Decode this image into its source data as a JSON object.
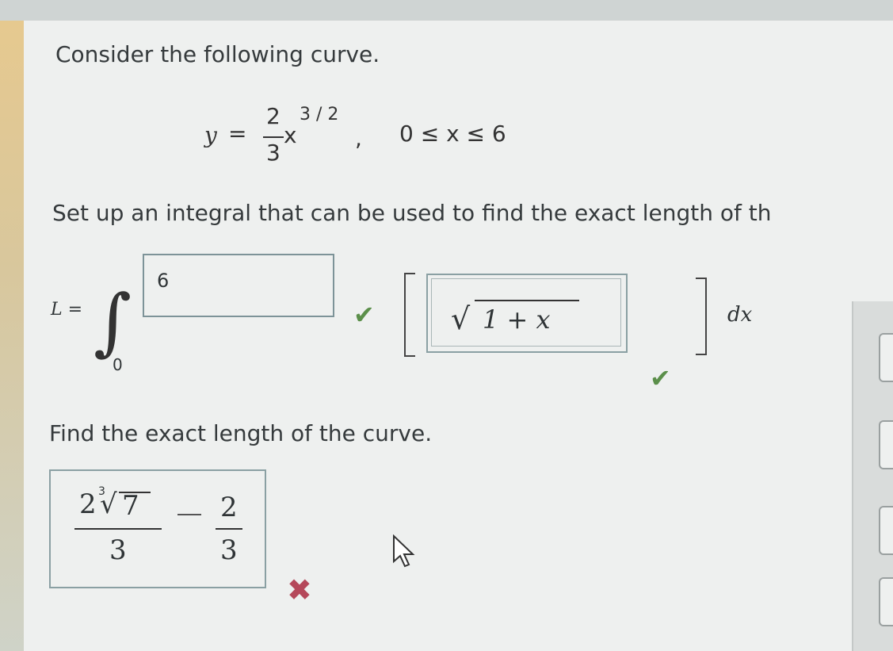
{
  "prompt": "Consider the following curve.",
  "equation": {
    "lhs": "y",
    "equals": "=",
    "numerator": "2",
    "denominator": "3",
    "var": "x",
    "exponent": "3 / 2",
    "comma": ",",
    "domain": "0 ≤ x ≤ 6"
  },
  "instruction": "Set up an integral that can be used to find the exact length of th",
  "integral": {
    "label": "L =",
    "symbol": "∫",
    "lower_limit": "0",
    "upper_limit": "6",
    "integrand": "1 + x",
    "sqrt_symbol": "√",
    "bracket_left": "[",
    "bracket_right": "]",
    "differential": "dx"
  },
  "find_length_prompt": "Find the exact length of the curve.",
  "answer": {
    "coeff": "2",
    "root_index": "3",
    "radicand": "7",
    "denominator1": "3",
    "numerator2": "2",
    "denominator2": "3"
  },
  "status_icons": {
    "correct": "✔",
    "incorrect": "✖",
    "correct_color": "#5b8f4a",
    "incorrect_color": "#b5485a"
  }
}
